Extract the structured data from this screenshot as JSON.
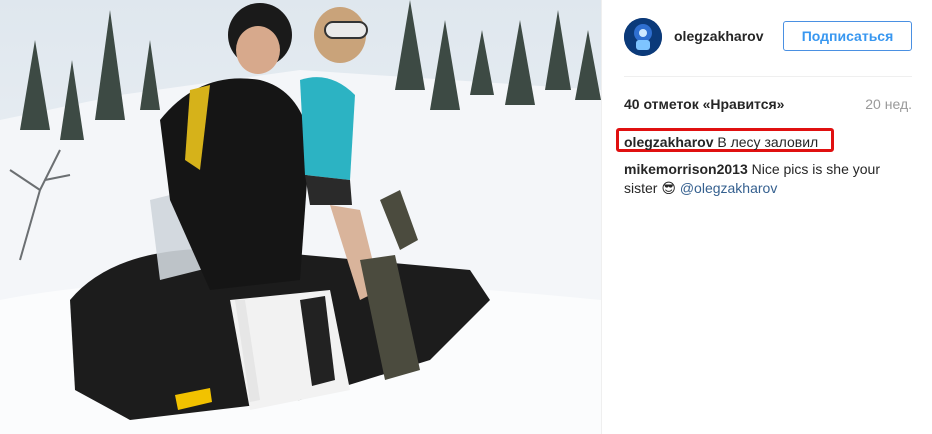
{
  "post": {
    "photo_icon": "photo-snowmobile",
    "author": {
      "username": "olegzakharov",
      "avatar_icon": "avatar-icon"
    },
    "follow_button": {
      "label": "Подписаться"
    },
    "likes_text": "40 отметок «Нравится»",
    "time_ago": "20 нед.",
    "caption": {
      "username": "olegzakharov",
      "text": "В лесу заловил",
      "highlight_color": "#e01010"
    },
    "comments": [
      {
        "username": "mikemorrison2013",
        "text": "Nice pics is she your sister",
        "emoji": "😎",
        "mention": "@olegzakharov"
      }
    ]
  },
  "colors": {
    "accent": "#3897f0",
    "mention": "#35608f",
    "muted": "#999999"
  }
}
